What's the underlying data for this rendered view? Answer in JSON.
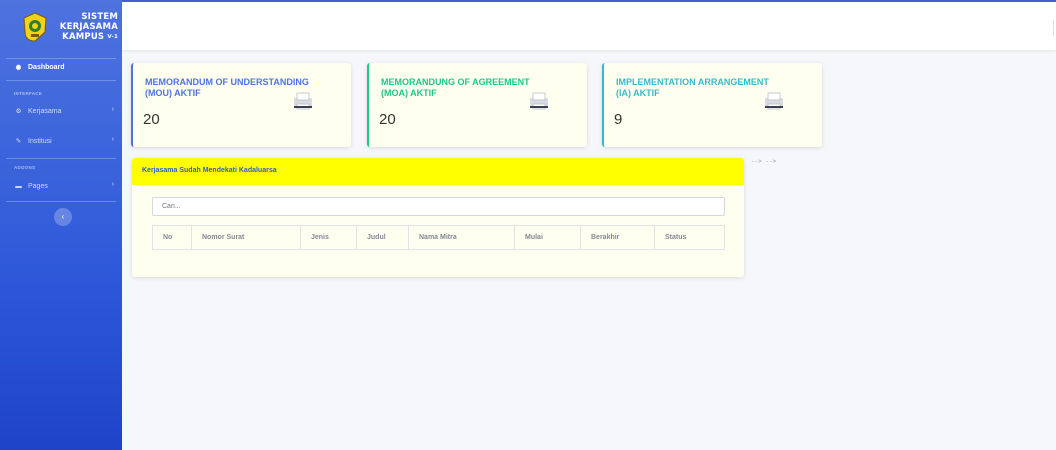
{
  "brand": {
    "line1": "SISTEM",
    "line2": "KERJASAMA",
    "line3": "KAMPUS",
    "version": "V-1"
  },
  "sidebar": {
    "dashboard": "Dashboard",
    "heading_interface": "INTERFACE",
    "items": [
      {
        "label": "Kerjasama",
        "icon": "gear-icon"
      },
      {
        "label": "Institusi",
        "icon": "wrench-icon"
      }
    ],
    "heading_addons": "ADDONS",
    "pages": "Pages",
    "toggle_glyph": "‹"
  },
  "cards": [
    {
      "label": "MEMORANDUM OF UNDERSTANDING (MOU) AKTIF",
      "value": "20",
      "accent": "#4e73df",
      "label_color": "#4e73df"
    },
    {
      "label": "MEMORANDUNG OF AGREEMENT (MOA) AKTIF",
      "value": "20",
      "accent": "#1cc88a",
      "label_color": "#1cc88a"
    },
    {
      "label": "IMPLEMENTATION ARRANGEMENT (IA) AKTIF",
      "value": "9",
      "accent": "#36b9cc",
      "label_color": "#36b9cc"
    }
  ],
  "panel": {
    "title": "Kerjasama Sudah Mendekati Kadaluarsa",
    "search_placeholder": "Cari...",
    "columns": [
      "No",
      "Nomor Surat",
      "Jenis",
      "Judul",
      "Nama Mitra",
      "Mulai",
      "Berakhir",
      "Status"
    ]
  },
  "stray_text": "--> -->"
}
